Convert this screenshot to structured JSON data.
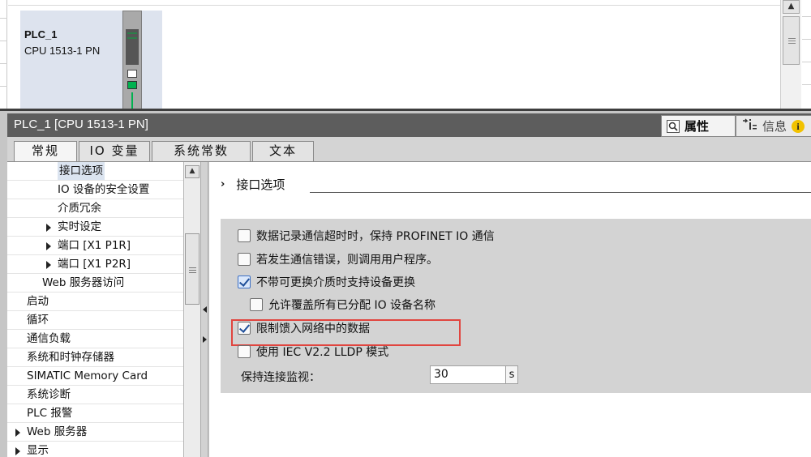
{
  "device": {
    "name": "PLC_1",
    "type": "CPU 1513-1 PN"
  },
  "inspector": {
    "title": "PLC_1 [CPU 1513-1 PN]",
    "properties_tab": "属性",
    "info_tab": "信息",
    "info_icon_glyph": "i",
    "subtabs": [
      "常规",
      "IO 变量",
      "系统常数",
      "文本"
    ]
  },
  "nav": {
    "items": [
      {
        "label": "接口选项",
        "indent": 2,
        "arrow": false,
        "selected": true
      },
      {
        "label": "IO 设备的安全设置",
        "indent": 2,
        "arrow": false
      },
      {
        "label": "介质冗余",
        "indent": 2,
        "arrow": false
      },
      {
        "label": "实时设定",
        "indent": 2,
        "arrow": true
      },
      {
        "label": "端口 [X1 P1R]",
        "indent": 2,
        "arrow": true
      },
      {
        "label": "端口 [X1 P2R]",
        "indent": 2,
        "arrow": true
      },
      {
        "label": "Web 服务器访问",
        "indent": 1,
        "arrow": false
      },
      {
        "label": "启动",
        "indent": 0,
        "arrow": false
      },
      {
        "label": "循环",
        "indent": 0,
        "arrow": false
      },
      {
        "label": "通信负载",
        "indent": 0,
        "arrow": false
      },
      {
        "label": "系统和时钟存储器",
        "indent": 0,
        "arrow": false
      },
      {
        "label": "SIMATIC Memory Card",
        "indent": 0,
        "arrow": false
      },
      {
        "label": "系统诊断",
        "indent": 0,
        "arrow": false
      },
      {
        "label": "PLC 报警",
        "indent": 0,
        "arrow": false
      },
      {
        "label": "Web 服务器",
        "indent": 0,
        "arrow": true
      },
      {
        "label": "显示",
        "indent": 0,
        "arrow": true
      }
    ]
  },
  "content": {
    "section_title": "接口选项",
    "options": [
      {
        "label": "数据记录通信超时时，保持 PROFINET IO 通信",
        "checked": false
      },
      {
        "label": "若发生通信错误，则调用用户程序。",
        "checked": false
      },
      {
        "label": "不带可更换介质时支持设备更换",
        "checked": true
      },
      {
        "label": "允许覆盖所有已分配 IO 设备名称",
        "checked": false
      },
      {
        "label": "限制馈入网络中的数据",
        "checked": true
      },
      {
        "label": "使用 IEC V2.2 LLDP 模式",
        "checked": false
      }
    ],
    "keepalive_label": "保持连接监视：",
    "keepalive_value": "30",
    "keepalive_unit": "s"
  },
  "colors": {
    "highlight": "#e1453f",
    "titlebar": "#5d5d5d",
    "status_green": "#00b14f"
  }
}
